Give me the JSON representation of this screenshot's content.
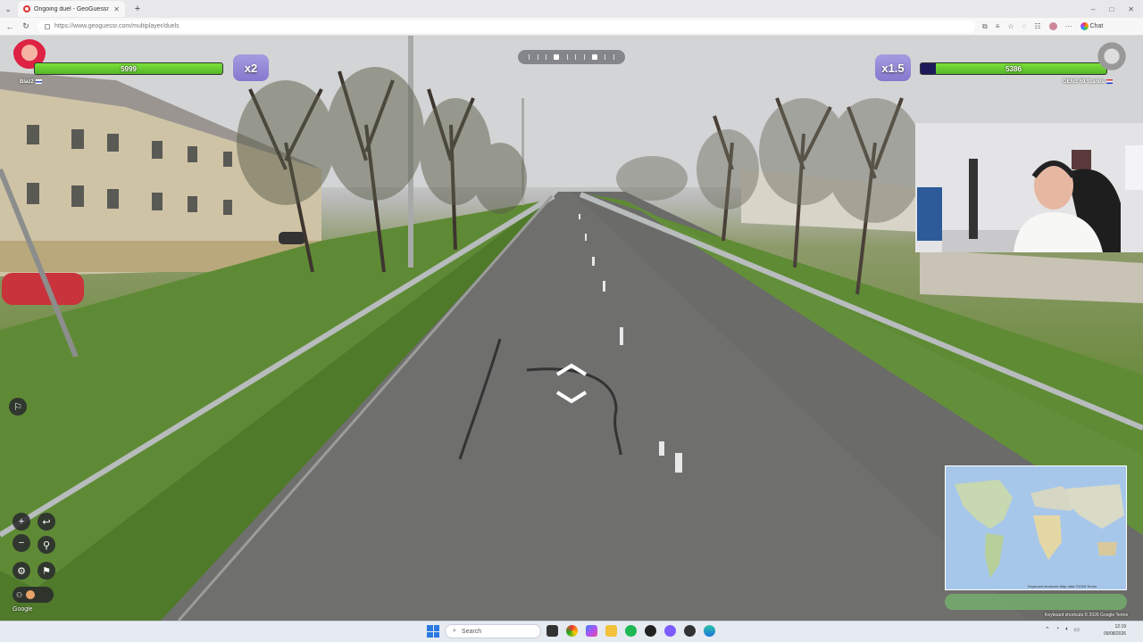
{
  "browser": {
    "tab_title": "Ongoing duel - GeoGuessr",
    "new_tab_label": "+",
    "url": "https://www.geoguessr.com/multiplayer/duels",
    "profile_label": "Chat",
    "window_controls": [
      "–",
      "□",
      "✕"
    ]
  },
  "players": {
    "left": {
      "name": "Blaz2",
      "health": "5999",
      "health_fraction": 1.0,
      "multiplier": "x2",
      "flag": "Finland"
    },
    "right": {
      "name": "69 Stands",
      "tag": "GENS",
      "health": "5386",
      "health_fraction": 0.92,
      "multiplier": "x1.5",
      "flag": "Netherlands"
    }
  },
  "controls": {
    "zoom_in": "+",
    "zoom_out": "−",
    "undo": "↩",
    "pin": "⚲",
    "settings": "⚙",
    "flag": "⚑",
    "brand": "Google"
  },
  "minimap": {
    "credits": "Keyboard shortcuts   Map data ©2026   Terms",
    "footer_credits": "Keyboard shortcuts   © 2026 Google   Terms"
  },
  "taskbar": {
    "search_placeholder": "Search",
    "time": "12:19",
    "date": "09/08/2026"
  },
  "icons": [
    "tab-menu-icon",
    "back-icon",
    "refresh-icon",
    "lock-icon",
    "star-icon",
    "copilot-icon",
    "compass-icon",
    "arrow-up-icon",
    "arrow-down-icon",
    "report-icon",
    "zoom-in-icon",
    "zoom-out-icon",
    "undo-icon",
    "pin-icon",
    "gear-icon",
    "flag-icon",
    "windows-icon",
    "search-icon"
  ]
}
